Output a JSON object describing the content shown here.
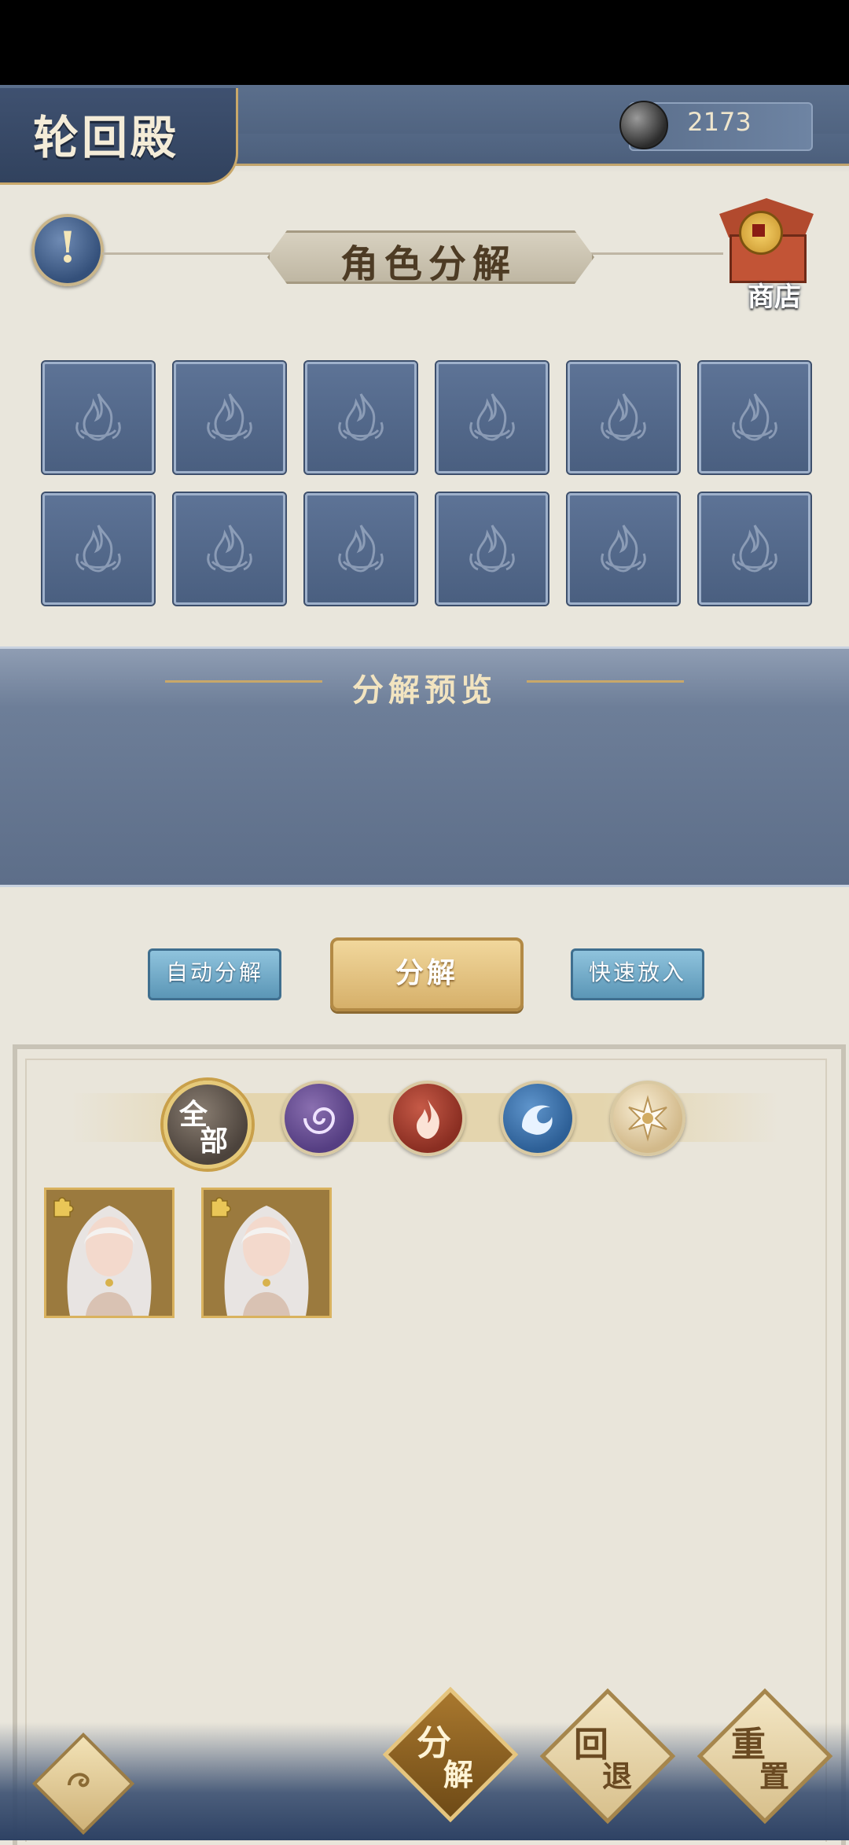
{
  "header": {
    "title": "轮回殿",
    "currency_value": "2173"
  },
  "section": {
    "title": "角色分解",
    "shop_label": "商店"
  },
  "slots": {
    "count": 12
  },
  "preview": {
    "title": "分解预览"
  },
  "actions": {
    "auto_decompose": "自动分解",
    "decompose": "分解",
    "quick_insert": "快速放入"
  },
  "filters": {
    "all_label_1": "全",
    "all_label_2": "部",
    "icons": [
      "all-icon",
      "swirl-element-icon",
      "fire-element-icon",
      "wave-element-icon",
      "sun-element-icon"
    ]
  },
  "characters": [
    {
      "name": "white-hair-character"
    },
    {
      "name": "white-hair-character"
    }
  ],
  "bottom_nav": {
    "decompose_1": "分",
    "decompose_2": "解",
    "undo_1": "回",
    "undo_2": "退",
    "reset_1": "重",
    "reset_2": "置"
  },
  "colors": {
    "accent_gold": "#c9a86a",
    "panel_blue": "#4a5f80",
    "button_blue": "#5b96b6"
  }
}
